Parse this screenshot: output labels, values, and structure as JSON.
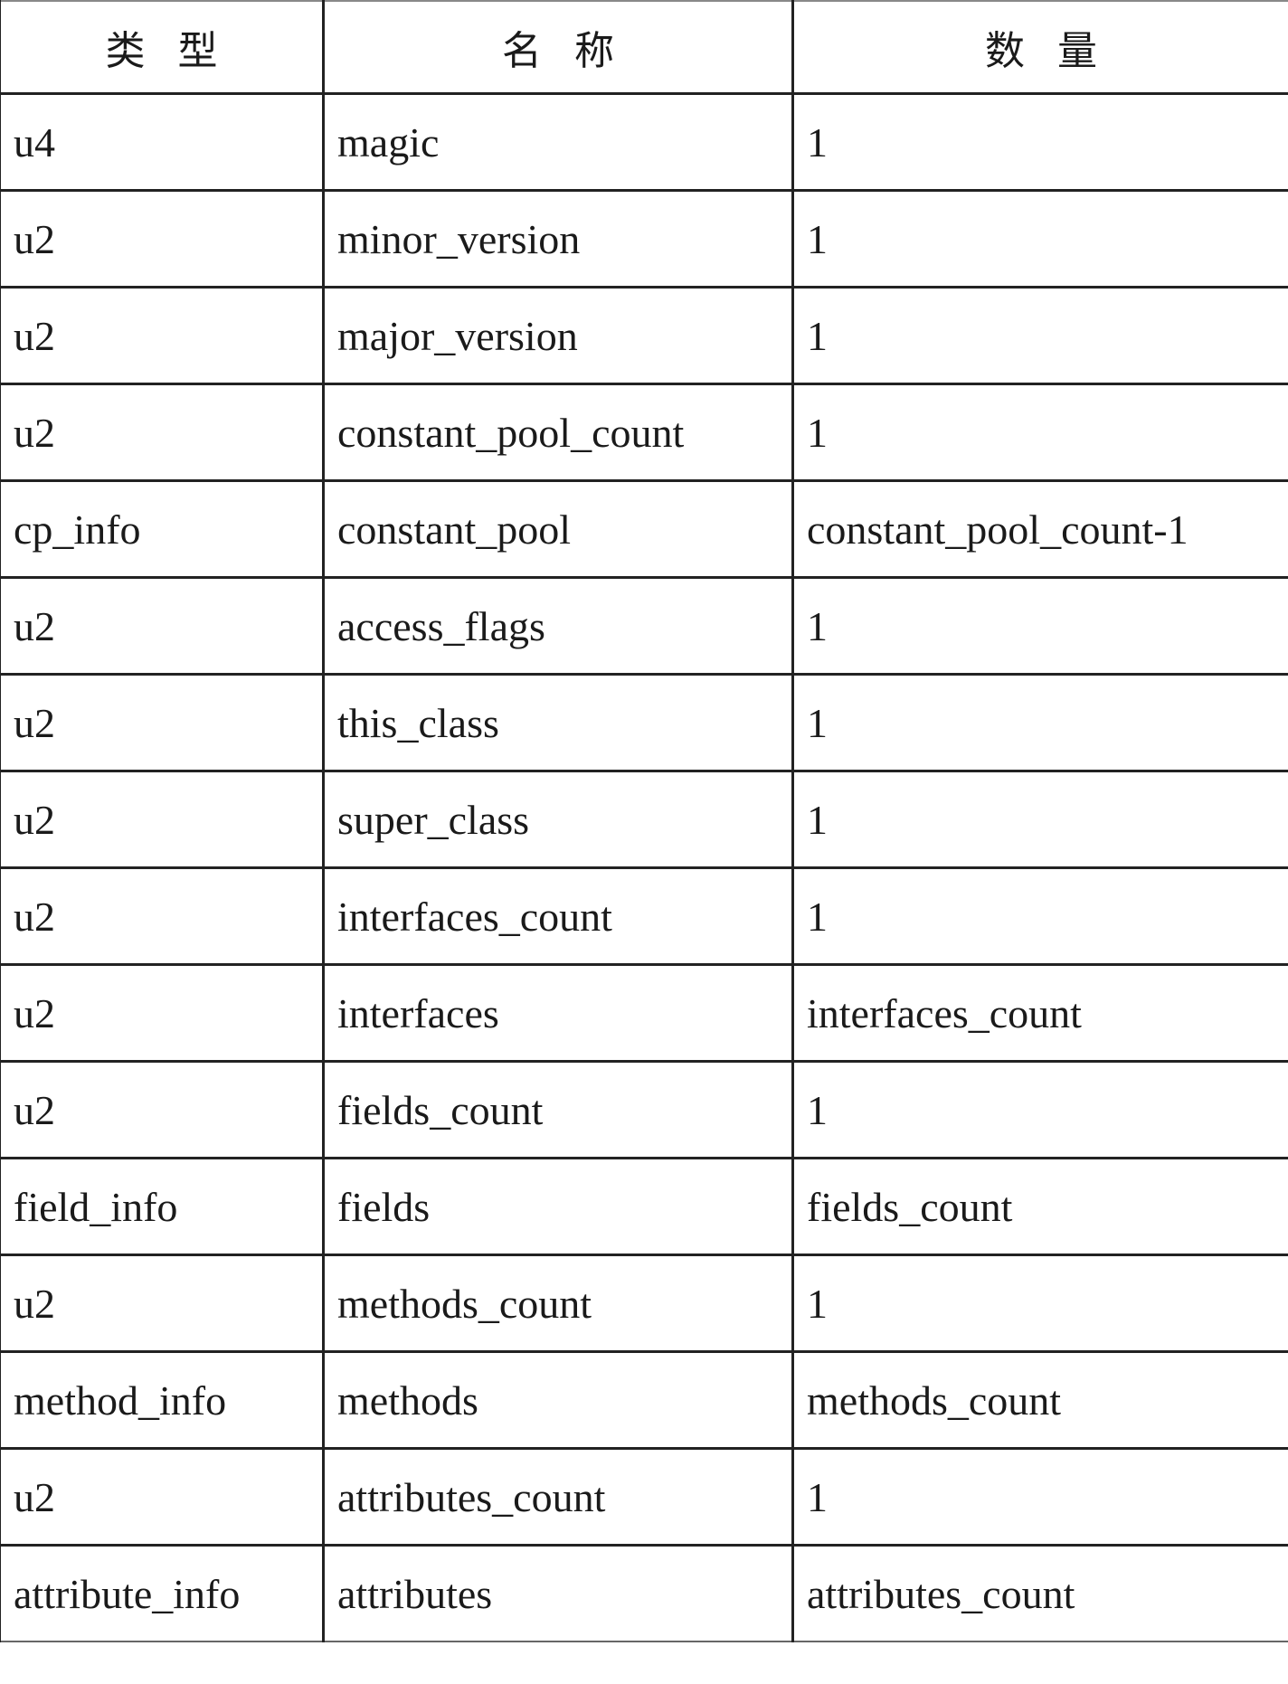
{
  "table": {
    "headers": [
      "类型",
      "名称",
      "数量"
    ],
    "rows": [
      [
        "u4",
        "magic",
        "1"
      ],
      [
        "u2",
        "minor_version",
        "1"
      ],
      [
        "u2",
        "major_version",
        "1"
      ],
      [
        "u2",
        "constant_pool_count",
        "1"
      ],
      [
        "cp_info",
        "constant_pool",
        "constant_pool_count-1"
      ],
      [
        "u2",
        "access_flags",
        "1"
      ],
      [
        "u2",
        "this_class",
        "1"
      ],
      [
        "u2",
        "super_class",
        "1"
      ],
      [
        "u2",
        "interfaces_count",
        "1"
      ],
      [
        "u2",
        "interfaces",
        "interfaces_count"
      ],
      [
        "u2",
        "fields_count",
        "1"
      ],
      [
        "field_info",
        "fields",
        "fields_count"
      ],
      [
        "u2",
        "methods_count",
        "1"
      ],
      [
        "method_info",
        "methods",
        "methods_count"
      ],
      [
        "u2",
        "attributes_count",
        "1"
      ],
      [
        "attribute_info",
        "attributes",
        "attributes_count"
      ]
    ]
  }
}
